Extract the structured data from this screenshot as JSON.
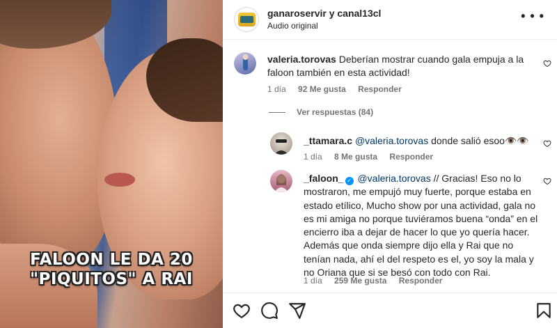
{
  "media": {
    "caption_line1": "FALOON LE DA 20",
    "caption_line2": "\"PIQUITOS\" A RAI"
  },
  "header": {
    "account_names": "ganaroservir y canal13cl",
    "audio_label": "Audio original",
    "more_icon": "more-horizontal-icon"
  },
  "comments": [
    {
      "username": "valeria.torovas",
      "text": "Deberían mostrar cuando gala empuja a la faloon también en esta actividad!",
      "time": "1 día",
      "likes": "92 Me gusta",
      "reply_label": "Responder"
    }
  ],
  "view_replies": "Ver respuestas (84)",
  "replies": [
    {
      "username": "_ttamara.c",
      "mention": "@valeria.torovas",
      "text": " donde salió esoo👁️👁️",
      "time": "1 día",
      "likes": "8 Me gusta",
      "reply_label": "Responder"
    },
    {
      "username": "_faloon_",
      "mention": "@valeria.torovas",
      "text": " // Gracias! Eso no lo mostraron, me empujó muy fuerte, porque estaba en estado etílico, Mucho show por una actividad, gala no es mi amiga no porque tuviéramos buena “onda” en el encierro iba a dejar de hacer lo que yo quería hacer. Además que onda siempre dijo ella y Rai que no tenían nada, ahí el del respeto es el, yo soy la mala y no Oriana que si se besó con todo con Rai.",
      "time": "1 día",
      "likes": "259 Me gusta",
      "reply_label": "Responder",
      "verified": true
    }
  ],
  "actions": [
    "heart-icon",
    "comment-icon",
    "share-icon",
    "bookmark-icon"
  ],
  "colors": {
    "link": "#00376b",
    "meta": "#737373",
    "verified": "#0095f6"
  }
}
